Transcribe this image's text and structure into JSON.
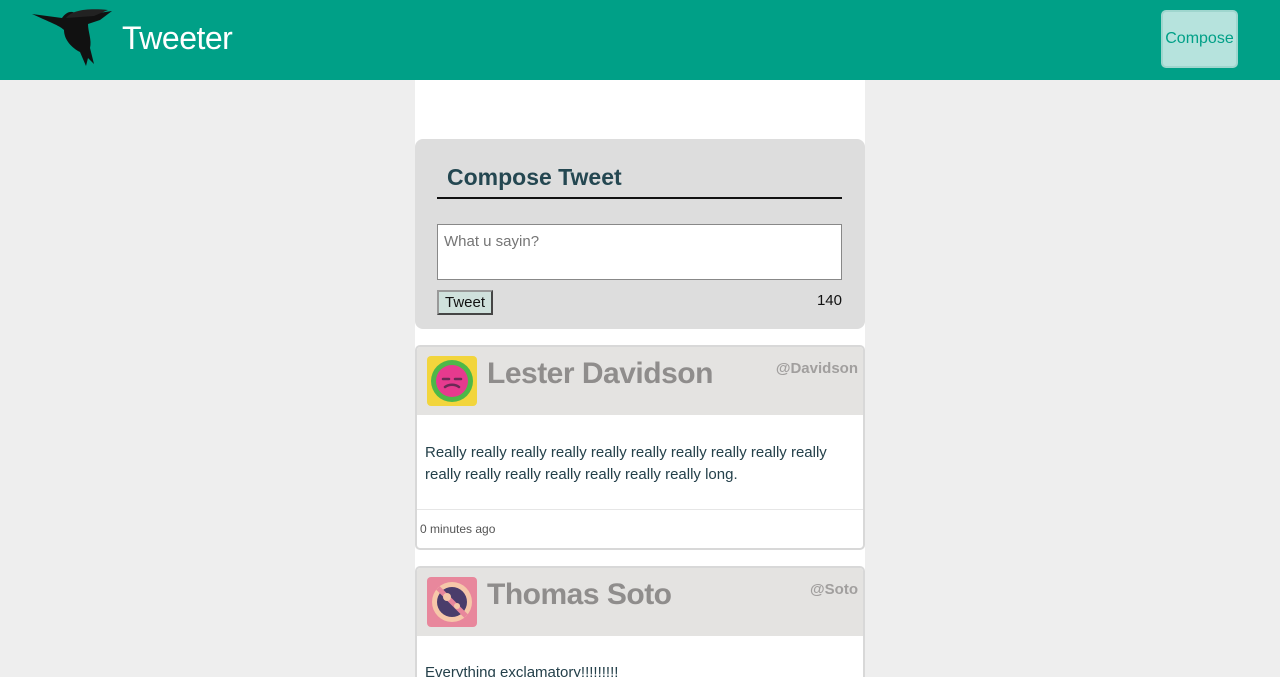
{
  "nav": {
    "brand": "Tweeter",
    "compose_label": "Compose",
    "color": "#00a087"
  },
  "compose": {
    "title": "Compose Tweet",
    "placeholder": "What u sayin?",
    "button_label": "Tweet",
    "counter": "140"
  },
  "tweets": [
    {
      "name": "Lester Davidson",
      "handle": "@Davidson",
      "content": "Really really really really really really really really really really really really really really really really really long.",
      "time": "0 minutes ago",
      "avatar_icon": "face-icon"
    },
    {
      "name": "Thomas Soto",
      "handle": "@Soto",
      "content": "Everything exclamatory!!!!!!!!!",
      "avatar_icon": "planet-icon"
    }
  ]
}
